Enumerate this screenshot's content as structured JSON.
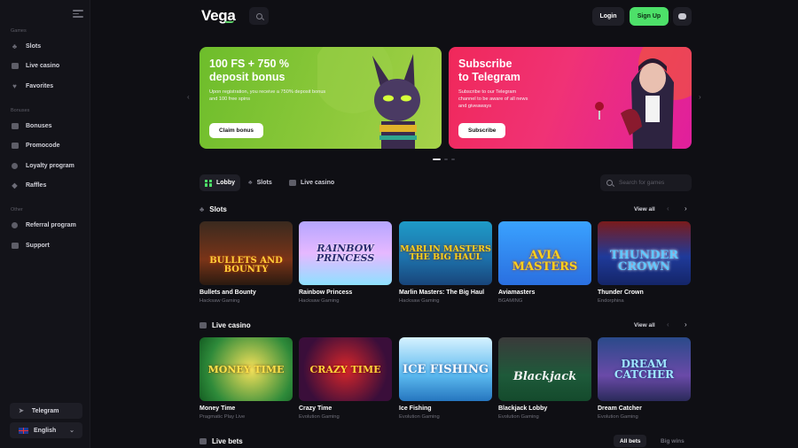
{
  "brand": {
    "name": "Vega",
    "accent": "#4de069"
  },
  "header": {
    "login": "Login",
    "signup": "Sign Up"
  },
  "sidebar": {
    "sections": [
      {
        "label": "Games",
        "items": [
          {
            "label": "Slots",
            "icon": "slot-icon"
          },
          {
            "label": "Live casino",
            "icon": "chat-icon"
          },
          {
            "label": "Favorites",
            "icon": "heart-icon"
          }
        ]
      },
      {
        "label": "Bonuses",
        "items": [
          {
            "label": "Bonuses",
            "icon": "gift-icon"
          },
          {
            "label": "Promocode",
            "icon": "tag-icon"
          },
          {
            "label": "Loyalty program",
            "icon": "medal-icon"
          },
          {
            "label": "Raffles",
            "icon": "ticket-icon"
          }
        ]
      },
      {
        "label": "Other",
        "items": [
          {
            "label": "Referral program",
            "icon": "people-icon"
          },
          {
            "label": "Support",
            "icon": "support-icon"
          }
        ]
      }
    ],
    "telegram": "Telegram",
    "language": "English"
  },
  "banners": [
    {
      "title_line1": "100 FS + 750 %",
      "title_line2": "deposit bonus",
      "text": "Upon registration, you receive a 750% deposit bonus and 100 free spins",
      "button": "Claim bonus",
      "color": "#7ec234"
    },
    {
      "title_line1": "Subscribe",
      "title_line2": "to Telegram",
      "text": "Subscribe to our Telegram channel to be aware of all news and giveaways",
      "button": "Subscribe",
      "color": "#f0286e"
    }
  ],
  "tabs": [
    {
      "label": "Lobby",
      "active": true
    },
    {
      "label": "Slots"
    },
    {
      "label": "Live casino"
    }
  ],
  "search": {
    "placeholder": "Search for games"
  },
  "slots": {
    "title": "Slots",
    "view_all": "View all",
    "games": [
      {
        "name": "Bullets and Bounty",
        "provider": "Hacksaw Gaming",
        "art": "BULLETS AND BOUNTY"
      },
      {
        "name": "Rainbow Princess",
        "provider": "Hacksaw Gaming",
        "art": "RAINBOW PRINCESS"
      },
      {
        "name": "Marlin Masters: The Big Haul",
        "provider": "Hacksaw Gaming",
        "art": "MARLIN MASTERS THE BIG HAUL"
      },
      {
        "name": "Aviamasters",
        "provider": "BGAMING",
        "art": "AVIA MASTERS"
      },
      {
        "name": "Thunder Crown",
        "provider": "Endorphina",
        "art": "THUNDER CROWN"
      }
    ]
  },
  "live_casino": {
    "title": "Live casino",
    "view_all": "View all",
    "games": [
      {
        "name": "Money Time",
        "provider": "Pragmatic Play Live",
        "art": "MONEY TIME"
      },
      {
        "name": "Crazy Time",
        "provider": "Evolution Gaming",
        "art": "CRAZY TIME"
      },
      {
        "name": "Ice Fishing",
        "provider": "Evolution Gaming",
        "art": "ICE FISHING"
      },
      {
        "name": "Blackjack Lobby",
        "provider": "Evolution Gaming",
        "art": "Blackjack"
      },
      {
        "name": "Dream Catcher",
        "provider": "Evolution Gaming",
        "art": "DREAM CATCHER"
      }
    ]
  },
  "live_bets": {
    "title": "Live bets",
    "tabs": [
      "All bets",
      "Big wins"
    ]
  }
}
